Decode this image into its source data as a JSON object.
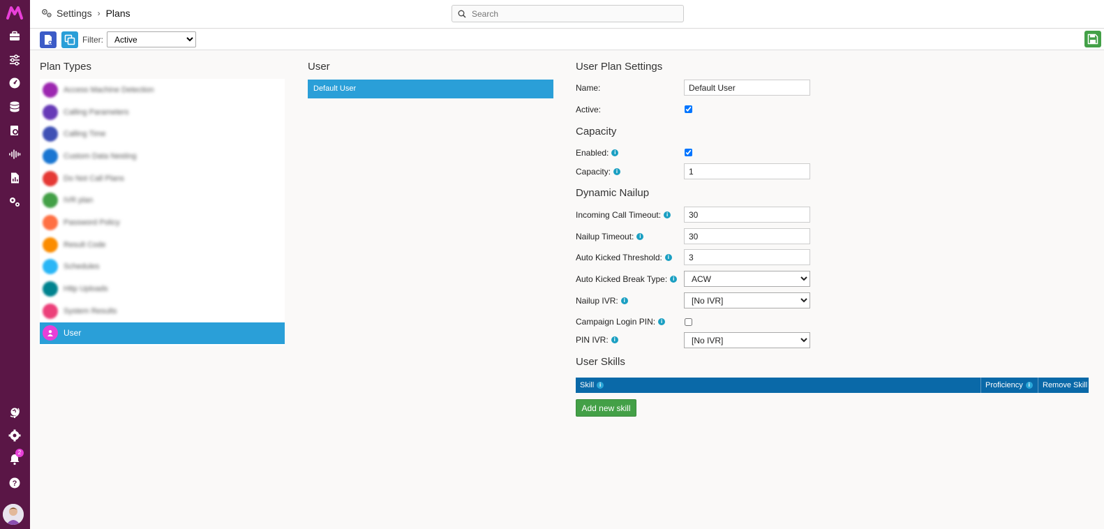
{
  "header": {
    "breadcrumb_root": "Settings",
    "breadcrumb_separator": "›",
    "breadcrumb_current": "Plans",
    "search_placeholder": "Search"
  },
  "toolbar": {
    "filter_label": "Filter:",
    "filter_value": "Active",
    "filter_options": [
      "Active"
    ]
  },
  "plan_types": {
    "title": "Plan Types",
    "items": [
      {
        "label": "Access Machine Detection",
        "color": "#9c27b0"
      },
      {
        "label": "Calling Parameters",
        "color": "#673ab7"
      },
      {
        "label": "Calling Time",
        "color": "#3f51b5"
      },
      {
        "label": "Custom Data Nesting",
        "color": "#1976d2"
      },
      {
        "label": "Do Not Call Plans",
        "color": "#e53935"
      },
      {
        "label": "IVR plan",
        "color": "#43a047"
      },
      {
        "label": "Password Policy",
        "color": "#ff7043"
      },
      {
        "label": "Result Code",
        "color": "#fb8c00"
      },
      {
        "label": "Schedules",
        "color": "#29b6f6"
      },
      {
        "label": "Http Uploads",
        "color": "#00838f"
      },
      {
        "label": "System Results",
        "color": "#ec407a"
      },
      {
        "label": "User",
        "color": "#e83fd8",
        "active": true
      }
    ]
  },
  "user_column": {
    "title": "User",
    "items": [
      "Default User"
    ]
  },
  "settings": {
    "title": "User Plan Settings",
    "name_label": "Name:",
    "name_value": "Default User",
    "active_label": "Active:",
    "active_checked": true,
    "capacity_title": "Capacity",
    "enabled_label": "Enabled:",
    "enabled_checked": true,
    "capacity_label": "Capacity:",
    "capacity_value": "1",
    "nailup_title": "Dynamic Nailup",
    "incoming_timeout_label": "Incoming Call Timeout:",
    "incoming_timeout_value": "30",
    "nailup_timeout_label": "Nailup Timeout:",
    "nailup_timeout_value": "30",
    "kicked_threshold_label": "Auto Kicked Threshold:",
    "kicked_threshold_value": "3",
    "kicked_break_label": "Auto Kicked Break Type:",
    "kicked_break_value": "ACW",
    "nailup_ivr_label": "Nailup IVR:",
    "nailup_ivr_value": "[No IVR]",
    "campaign_pin_label": "Campaign Login PIN:",
    "campaign_pin_checked": false,
    "pin_ivr_label": "PIN IVR:",
    "pin_ivr_value": "[No IVR]",
    "skills_title": "User Skills",
    "skills_headers": {
      "skill": "Skill",
      "proficiency": "Proficiency",
      "remove": "Remove Skill"
    },
    "add_skill_label": "Add new skill"
  },
  "notifications": {
    "count": "2"
  },
  "colors": {
    "sidebar": "#5a1646",
    "accent": "#2a9fd8",
    "table_header": "#0a69a8",
    "save": "#43a047"
  }
}
